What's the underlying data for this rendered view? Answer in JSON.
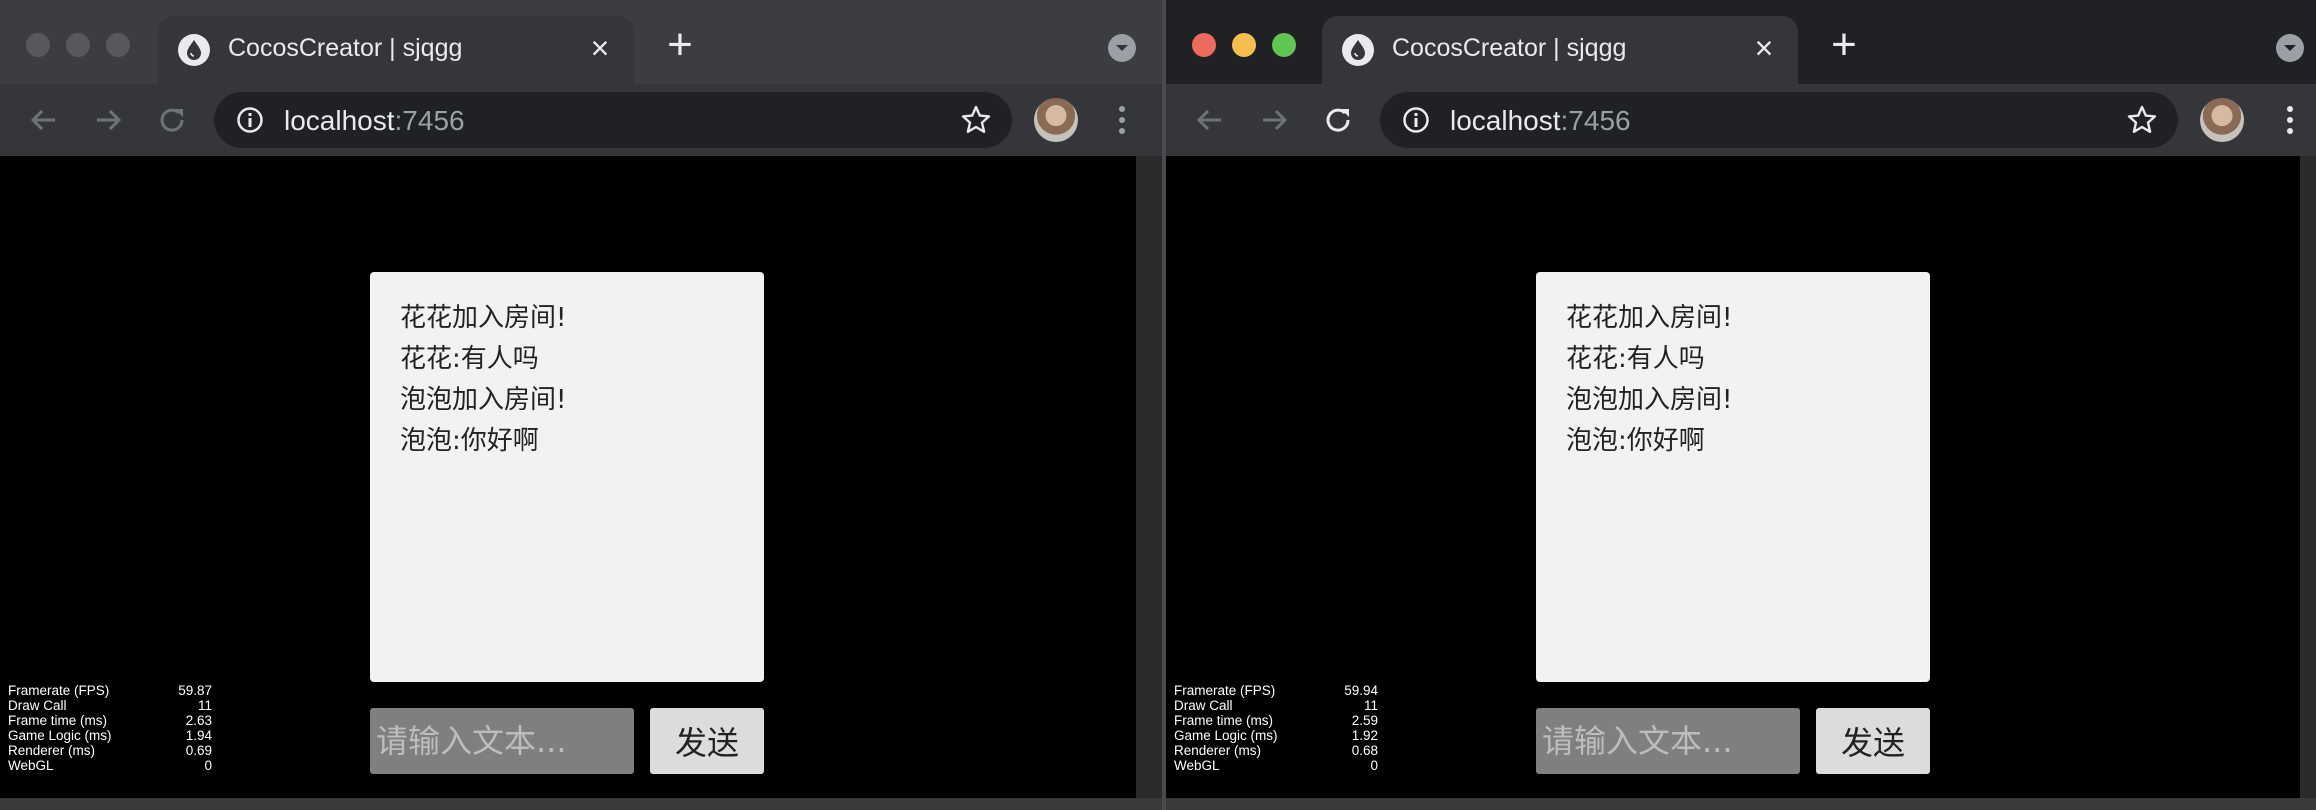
{
  "windows": [
    {
      "tab": {
        "title": "CocosCreator | sjqgg"
      },
      "url": {
        "host": "localhost",
        "port": ":7456"
      },
      "chat": {
        "messages": [
          "花花加入房间!",
          "花花:有人吗",
          "泡泡加入房间!",
          "泡泡:你好啊"
        ],
        "input_placeholder": "请输入文本...",
        "send_label": "发送"
      },
      "stats": [
        {
          "label": "Framerate (FPS)",
          "value": "59.87"
        },
        {
          "label": "Draw Call",
          "value": "11"
        },
        {
          "label": "Frame time (ms)",
          "value": "2.63"
        },
        {
          "label": "Game Logic (ms)",
          "value": "1.94"
        },
        {
          "label": "Renderer (ms)",
          "value": "0.69"
        },
        {
          "label": "WebGL",
          "value": "0"
        }
      ]
    },
    {
      "tab": {
        "title": "CocosCreator | sjqgg"
      },
      "url": {
        "host": "localhost",
        "port": ":7456"
      },
      "chat": {
        "messages": [
          "花花加入房间!",
          "花花:有人吗",
          "泡泡加入房间!",
          "泡泡:你好啊"
        ],
        "input_placeholder": "请输入文本...",
        "send_label": "发送"
      },
      "stats": [
        {
          "label": "Framerate (FPS)",
          "value": "59.94"
        },
        {
          "label": "Draw Call",
          "value": "11"
        },
        {
          "label": "Frame time (ms)",
          "value": "2.59"
        },
        {
          "label": "Game Logic (ms)",
          "value": "1.92"
        },
        {
          "label": "Renderer (ms)",
          "value": "0.68"
        },
        {
          "label": "WebGL",
          "value": "0"
        }
      ]
    }
  ],
  "icons": {
    "favicon": "cocos-drop-icon",
    "back": "arrow-left-icon",
    "forward": "arrow-right-icon",
    "reload": "reload-icon",
    "info": "info-icon",
    "bookmark": "star-icon",
    "menu": "kebab-menu-icon"
  },
  "colors": {
    "traffic_close": "#ec6a5e",
    "traffic_min": "#f4bf4f",
    "traffic_max": "#61c554",
    "chat_panel": "#f2f2f2",
    "send_button": "#dcdcdc",
    "input_bg": "#7f7f7f"
  }
}
